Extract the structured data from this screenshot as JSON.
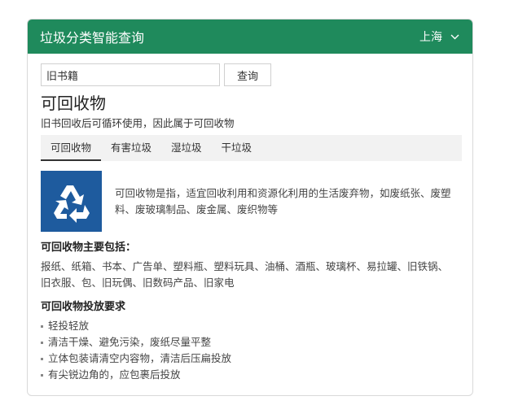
{
  "header": {
    "title": "垃圾分类智能查询",
    "city": "上海",
    "header_color": "#1f8a5c"
  },
  "search": {
    "value": "旧书籍",
    "button_label": "查询"
  },
  "result": {
    "category": "可回收物",
    "description": "旧书回收后可循环使用，因此属于可回收物"
  },
  "tabs": [
    {
      "label": "可回收物",
      "active": true
    },
    {
      "label": "有害垃圾",
      "active": false
    },
    {
      "label": "湿垃圾",
      "active": false
    },
    {
      "label": "干垃圾",
      "active": false
    }
  ],
  "intro": {
    "icon": "recycle-icon",
    "icon_bg": "#1e5b9e",
    "text": "可回收物是指，适宜回收利用和资源化利用的生活废弃物，如废纸张、废塑料、废玻璃制品、废金属、废织物等"
  },
  "includes": {
    "title": "可回收物主要包括：",
    "text": "报纸、纸箱、书本、广告单、塑料瓶、塑料玩具、油桶、酒瓶、玻璃杯、易拉罐、旧铁锅、旧衣服、包、旧玩偶、旧数码产品、旧家电"
  },
  "requirements": {
    "title": "可回收物投放要求",
    "items": [
      "轻投轻放",
      "清洁干燥、避免污染，废纸尽量平整",
      "立体包装请清空内容物，清洁后压扁投放",
      "有尖锐边角的，应包裹后投放"
    ]
  }
}
